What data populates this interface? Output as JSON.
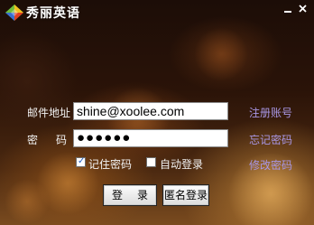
{
  "window": {
    "title": "秀丽英语",
    "logo_icon": "colored-diamond-logo-icon",
    "minimize_icon": "minimize-icon",
    "close_icon": "close-icon"
  },
  "login_form": {
    "username_label_a": "邮件地址",
    "password_label_a": "密",
    "password_label_b": "码",
    "username_value": "shine@xoolee.com",
    "password_value": "●●●●●●",
    "remember_label": "记住密码",
    "remember_checked": true,
    "auto_login_label": "自动登录",
    "auto_login_checked": false
  },
  "links": {
    "register": "注册账号",
    "forgot_password": "忘记密码",
    "change_password": "修改密码"
  },
  "buttons": {
    "login_a": "登",
    "login_b": "录",
    "anonymous_login": "匿名登录"
  },
  "colors": {
    "link": "#a896e4",
    "label": "#f2f2f2",
    "title": "#ffffff"
  }
}
